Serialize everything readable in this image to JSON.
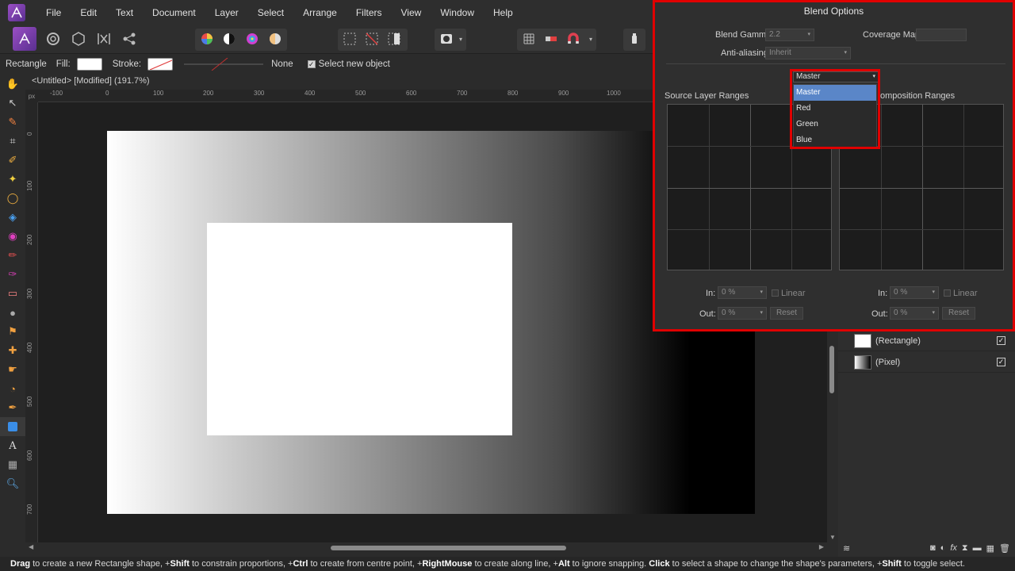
{
  "menu": [
    "File",
    "Edit",
    "Text",
    "Document",
    "Layer",
    "Select",
    "Arrange",
    "Filters",
    "View",
    "Window",
    "Help"
  ],
  "context": {
    "tool_name": "Rectangle",
    "fill_label": "Fill:",
    "stroke_label": "Stroke:",
    "line_value": "None",
    "select_new_object": "Select new object"
  },
  "document": {
    "title": "<Untitled> [Modified] (191.7%)",
    "ruler_unit": "px",
    "h_ticks": [
      "-100",
      "0",
      "100",
      "200",
      "300",
      "400",
      "500",
      "600",
      "700",
      "800",
      "900",
      "1000"
    ],
    "v_ticks": [
      "0",
      "100",
      "200",
      "300",
      "400",
      "500",
      "600",
      "700"
    ]
  },
  "layers": [
    {
      "name": "(Rectangle)",
      "checked": true
    },
    {
      "name": "(Pixel)",
      "checked": true
    }
  ],
  "blend_options": {
    "title": "Blend Options",
    "blend_gamma_label": "Blend Gamma:",
    "blend_gamma_value": "2.2",
    "coverage_map_label": "Coverage Map:",
    "anti_aliasing_label": "Anti-aliasing:",
    "anti_aliasing_value": "Inherit",
    "channel_selected": "Master",
    "channel_options": [
      "Master",
      "Red",
      "Green",
      "Blue"
    ],
    "source_ranges_label": "Source Layer Ranges",
    "composition_ranges_label": "omposition Ranges",
    "in_label": "In:",
    "out_label": "Out:",
    "in_value": "0 %",
    "out_value": "0 %",
    "linear_label": "Linear",
    "reset_label": "Reset"
  },
  "status": {
    "segments": [
      {
        "b": "Drag",
        "t": " to create a new Rectangle shape, +"
      },
      {
        "b": "Shift",
        "t": " to constrain proportions, +"
      },
      {
        "b": "Ctrl",
        "t": " to create from centre point, +"
      },
      {
        "b": "RightMouse",
        "t": " to create along line, +"
      },
      {
        "b": "Alt",
        "t": " to ignore snapping. "
      },
      {
        "b": "Click",
        "t": " to select a shape to change the shape's parameters, +"
      },
      {
        "b": "Shift",
        "t": " to toggle select."
      }
    ]
  }
}
